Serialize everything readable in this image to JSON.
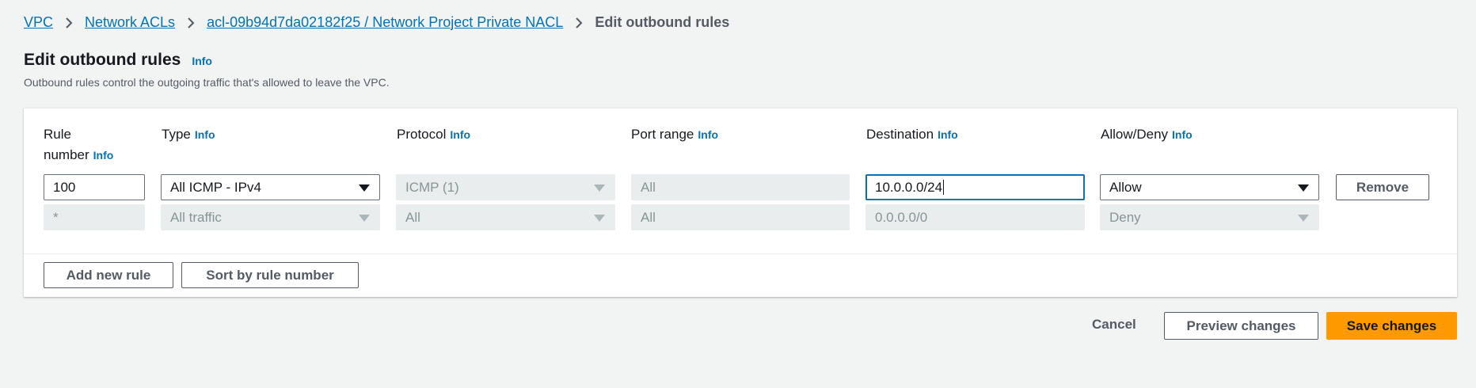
{
  "breadcrumb": {
    "items": [
      "VPC",
      "Network ACLs",
      "acl-09b94d7da02182f25 / Network Project Private NACL"
    ],
    "current": "Edit outbound rules"
  },
  "page": {
    "title": "Edit outbound rules",
    "info": "Info",
    "subtitle": "Outbound rules control the outgoing traffic that's allowed to leave the VPC."
  },
  "table": {
    "headers": {
      "rule_number_line1": "Rule",
      "rule_number_line2": "number",
      "type": "Type",
      "protocol": "Protocol",
      "port_range": "Port range",
      "destination": "Destination",
      "allow_deny": "Allow/Deny",
      "info": "Info"
    },
    "rows": [
      {
        "rule_number": "100",
        "type": "All ICMP - IPv4",
        "protocol": "ICMP (1)",
        "port_range": "All",
        "destination": "10.0.0.0/24",
        "allow_deny": "Allow",
        "remove": "Remove"
      },
      {
        "rule_number": "*",
        "type": "All traffic",
        "protocol": "All",
        "port_range": "All",
        "destination": "0.0.0.0/0",
        "allow_deny": "Deny"
      }
    ],
    "add_rule": "Add new rule",
    "sort_rule": "Sort by rule number"
  },
  "footer": {
    "cancel": "Cancel",
    "preview": "Preview changes",
    "save": "Save changes"
  },
  "colors": {
    "link": "#0073bb",
    "primary": "#ff9900",
    "background": "#f2f3f3"
  }
}
